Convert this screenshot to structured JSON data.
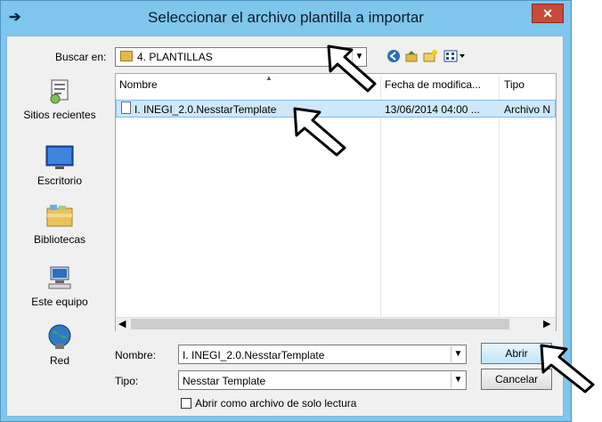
{
  "window": {
    "title": "Seleccionar el archivo plantilla a importar",
    "close_glyph": "✕",
    "app_icon": "arrow-icon"
  },
  "lookin": {
    "label": "Buscar en:",
    "value": "4. PLANTILLAS",
    "toolbar_icons": [
      "back-icon",
      "up-folder-icon",
      "new-folder-icon",
      "view-menu-icon"
    ]
  },
  "places": [
    {
      "label": "Sitios recientes",
      "icon": "recent-places-icon"
    },
    {
      "label": "Escritorio",
      "icon": "desktop-icon"
    },
    {
      "label": "Bibliotecas",
      "icon": "libraries-icon"
    },
    {
      "label": "Este equipo",
      "icon": "computer-icon"
    },
    {
      "label": "Red",
      "icon": "network-icon"
    }
  ],
  "list": {
    "columns": [
      "Nombre",
      "Fecha de modifica...",
      "Tipo"
    ],
    "rows": [
      {
        "name": "I. INEGI_2.0.NesstarTemplate",
        "date": "13/06/2014 04:00 ...",
        "type": "Archivo N"
      }
    ]
  },
  "form": {
    "name_label": "Nombre:",
    "name_value": "I. INEGI_2.0.NesstarTemplate",
    "type_label": "Tipo:",
    "type_value": "Nesstar Template",
    "readonly_label": "Abrir como archivo de solo lectura",
    "open_label": "Abrir",
    "cancel_label": "Cancelar"
  },
  "colors": {
    "titlebar": "#7ec6ec",
    "close": "#c74a3a",
    "selection": "#cde8fa"
  }
}
